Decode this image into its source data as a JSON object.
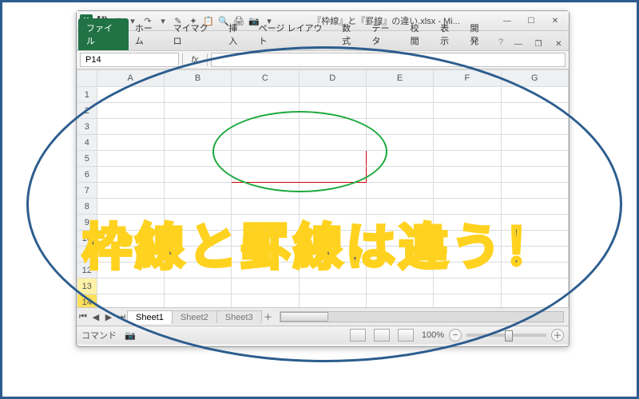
{
  "window": {
    "title": "『枠線』と『罫線』の違い.xlsx - Mi...",
    "logo_letter": "X"
  },
  "qat": {
    "save": "💾",
    "undo": "↶",
    "redo": "↷",
    "dropdown": "▾"
  },
  "win_controls": {
    "minimize": "—",
    "maximize": "☐",
    "close": "✕",
    "child_min": "—",
    "child_restore": "❐",
    "child_close": "✕"
  },
  "ribbon": {
    "file": "ファイル",
    "tabs": [
      "ホーム",
      "マイマクロ",
      "挿入",
      "ページ レイアウト",
      "数式",
      "データ",
      "校閲",
      "表示",
      "開発"
    ],
    "help": "?"
  },
  "namebox": {
    "value": "P14"
  },
  "fx": {
    "label": "fx"
  },
  "columns": [
    "A",
    "B",
    "C",
    "D",
    "E",
    "F",
    "G"
  ],
  "rows": [
    "1",
    "2",
    "3",
    "4",
    "5",
    "6",
    "7",
    "8",
    "9",
    "10",
    "11",
    "12",
    "13",
    "14"
  ],
  "sheets": {
    "nav": {
      "first": "⏮",
      "prev": "◀",
      "next": "▶",
      "last": "⏭"
    },
    "tabs": [
      "Sheet1",
      "Sheet2",
      "Sheet3"
    ],
    "new": "＋"
  },
  "status": {
    "mode": "コマンド",
    "rec": "📷",
    "zoom_pct": "100%",
    "minus": "−",
    "plus": "＋"
  },
  "annotation": {
    "headline": "枠線と罫線は違う！"
  },
  "chart_data": null
}
